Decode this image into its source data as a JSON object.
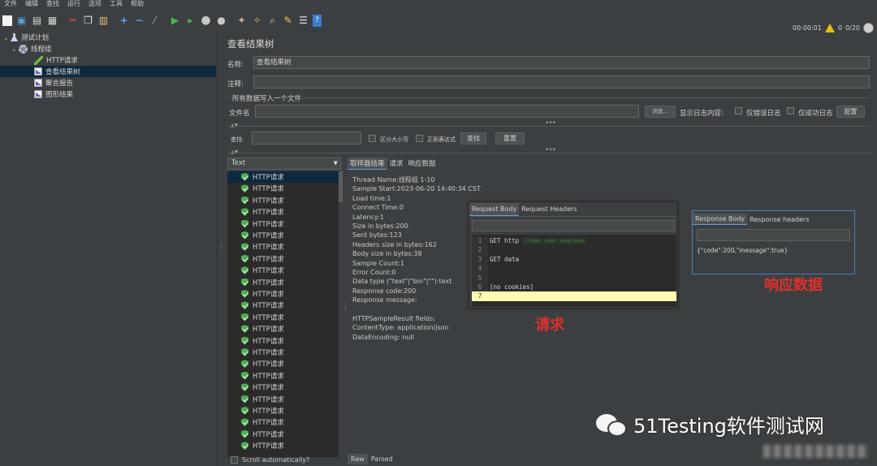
{
  "menu": [
    "文件",
    "编辑",
    "查找",
    "运行",
    "选项",
    "工具",
    "帮助"
  ],
  "toolbar": {
    "icons": [
      "new-icon",
      "templates-icon",
      "open-icon",
      "save-icon",
      "cut-icon",
      "copy-icon",
      "paste-icon",
      "expand-icon",
      "collapse-icon",
      "toggle-icon",
      "start-icon",
      "start-no-pause-icon",
      "stop-icon",
      "shutdown-icon",
      "clear-icon",
      "clear-all-icon",
      "search-icon",
      "reset-search-icon",
      "function-helper-icon",
      "help-icon"
    ],
    "timer": "00:00:01",
    "warnings": "0",
    "threads": "0/20"
  },
  "tree": {
    "items": [
      {
        "label": "测试计划",
        "icon": "test-plan-icon"
      },
      {
        "label": "线程组",
        "icon": "thread-group-icon"
      },
      {
        "label": "HTTP请求",
        "icon": "http-sampler-icon"
      },
      {
        "label": "查看结果树",
        "icon": "results-tree-icon"
      },
      {
        "label": "聚合报告",
        "icon": "aggregate-report-icon"
      },
      {
        "label": "图形结果",
        "icon": "graph-results-icon"
      }
    ]
  },
  "panel": {
    "title": "查看结果树",
    "name_label": "名称:",
    "name_value": "查看结果树",
    "comment_label": "注释:",
    "comment_value": "",
    "file_group_title": "所有数据写入一个文件",
    "file_label": "文件名",
    "browse_label": "浏览...",
    "log_label": "显示日志内容:",
    "errors_only": "仅错误日志",
    "success_only": "仅成功日志",
    "configure_label": "配置",
    "search_label": "查找:",
    "case_sensitive": "区分大小写",
    "regex": "正则表达式",
    "find_label": "查找",
    "reset_label": "重置"
  },
  "samples": {
    "renderer": "Text",
    "item_label": "HTTP请求",
    "count": 24,
    "scroll_auto": "Scroll automatically?"
  },
  "result_tabs": [
    "取样器结果",
    "请求",
    "响应数据"
  ],
  "sampler_result": [
    "Thread Name:线程组 1-10",
    "Sample Start:2023-06-20 14:40:34 CST",
    "Load time:1",
    "Connect Time:0",
    "Latency:1",
    "Size in bytes:200",
    "Sent bytes:123",
    "Headers size in bytes:162",
    "Body size in bytes:38",
    "Sample Count:1",
    "Error Count:0",
    "Data type (\"text\"|\"bin\"|\"\"):text",
    "Response code:200",
    "Response message:",
    "",
    "HTTPSampleResult fields:",
    "ContentType: application/json",
    "DataEncoding: null"
  ],
  "bottom_tabs": [
    "Raw",
    "Parsed"
  ],
  "request_panel": {
    "tabs": [
      "Request Body",
      "Request Headers"
    ],
    "lines": [
      {
        "n": "1",
        "text": "GET http"
      },
      {
        "n": "2",
        "text": ""
      },
      {
        "n": "3",
        "text": "GET data"
      },
      {
        "n": "4",
        "text": ""
      },
      {
        "n": "5",
        "text": ""
      },
      {
        "n": "6",
        "text": "[no cookies]"
      },
      {
        "n": "7",
        "text": ""
      }
    ],
    "annotation": "请求"
  },
  "response_panel": {
    "tabs": [
      "Response Body",
      "Response headers"
    ],
    "body": "{\"code\":200,\"message\":true}",
    "annotation": "响应数据"
  },
  "watermark": {
    "text": "51Testing软件测试网"
  }
}
